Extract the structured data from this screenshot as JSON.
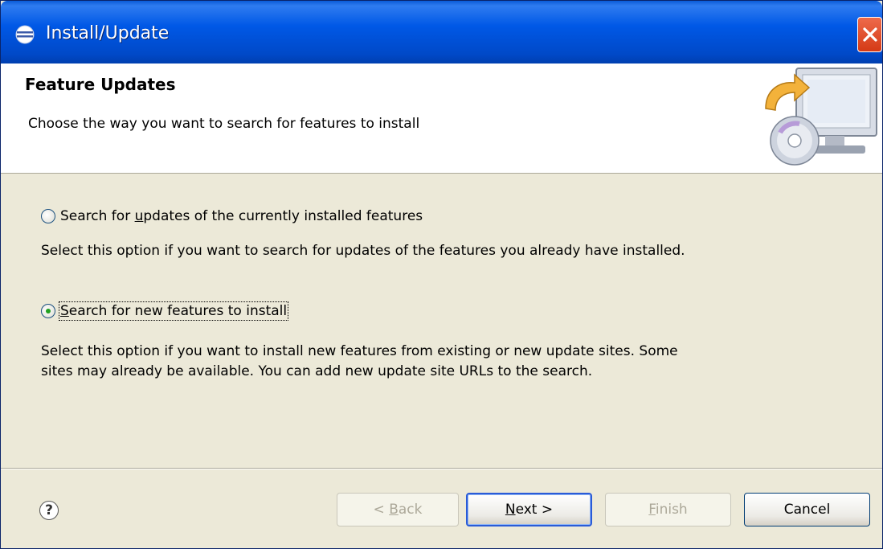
{
  "window": {
    "title": "Install/Update",
    "close_icon": "close-x-icon"
  },
  "banner": {
    "title": "Feature Updates",
    "description": "Choose the way you want to search for features to install",
    "graphic_icon": "computer-update-cd-icon"
  },
  "options": [
    {
      "label_pre": "Search for ",
      "label_mnemonic": "u",
      "label_post": "pdates of the currently installed features",
      "checked": false,
      "description": "Select this option if you want to search for updates of the features you already have installed."
    },
    {
      "label_pre": "",
      "label_mnemonic": "S",
      "label_post": "earch for new features to install",
      "checked": true,
      "description_line1": "Select this option if you want to install new features from existing or new update sites. Some",
      "description_line2": "sites may already be available. You can add new update site URLs to the search."
    }
  ],
  "footer": {
    "help_icon": "help-question-icon",
    "help_glyph": "?",
    "back": {
      "pre": "< ",
      "mnemonic": "B",
      "post": "ack",
      "enabled": false
    },
    "next": {
      "pre": "",
      "mnemonic": "N",
      "post": "ext >",
      "enabled": true
    },
    "finish": {
      "pre": "",
      "mnemonic": "F",
      "post": "inish",
      "enabled": false
    },
    "cancel": {
      "label": "Cancel",
      "enabled": true
    }
  },
  "colors": {
    "titlebar": "#0058e6",
    "dialog_bg": "#ece9d8",
    "radio_checked": "#21a121",
    "close_button": "#d43a16"
  }
}
